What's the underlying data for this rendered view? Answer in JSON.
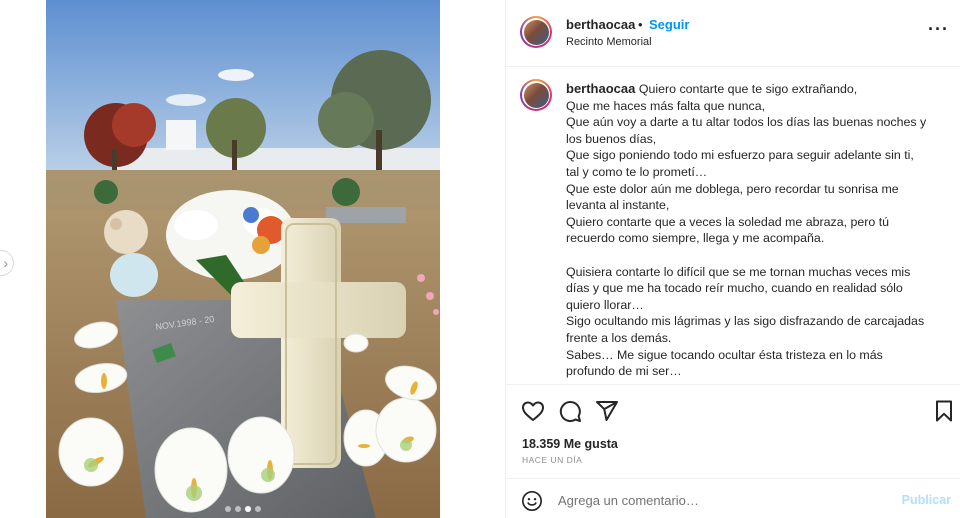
{
  "post": {
    "image_alt": "",
    "carousel": {
      "count": 4,
      "active": 3
    }
  },
  "header": {
    "username": "berthaocaa",
    "separator": "•",
    "follow_label": "Seguir",
    "location": "Recinto Memorial"
  },
  "caption": {
    "username": "berthaocaa",
    "lines": [
      "Quiero contarte que te sigo extrañando,",
      "Que me haces más falta que nunca,",
      "Que aún voy a darte a tu altar todos los días las buenas noches y",
      "los buenos días,",
      "Que sigo poniendo todo mi esfuerzo para seguir adelante sin ti,",
      "tal y como te lo prometí…",
      "Que este dolor aún me doblega, pero recordar tu sonrisa me",
      "levanta al instante,",
      "Quiero contarte que a veces la soledad me abraza, pero tú",
      "recuerdo como siempre, llega y me acompaña.",
      "",
      "Quisiera contarte lo difícil que se me tornan muchas veces mis",
      "días y que me ha tocado reír mucho, cuando en realidad sólo",
      "quiero llorar…",
      "Sigo ocultando mis lágrimas y las sigo disfrazando de carcajadas",
      "frente a los demás.",
      "Sabes… Me sigue tocando ocultar ésta tristeza en lo más",
      "profundo de mi ser…"
    ]
  },
  "actions": {
    "icons": [
      "heart-icon",
      "comment-icon",
      "share-icon",
      "bookmark-icon"
    ],
    "likes_text": "18.359 Me gusta",
    "time_text": "HACE UN DÍA"
  },
  "comment": {
    "placeholder": "Agrega un comentario…",
    "publish_label": "Publicar"
  },
  "colors": {
    "follow": "#0095f6",
    "publish_disabled": "#b2dffc",
    "muted": "#8e8e8e",
    "text": "#262626"
  }
}
